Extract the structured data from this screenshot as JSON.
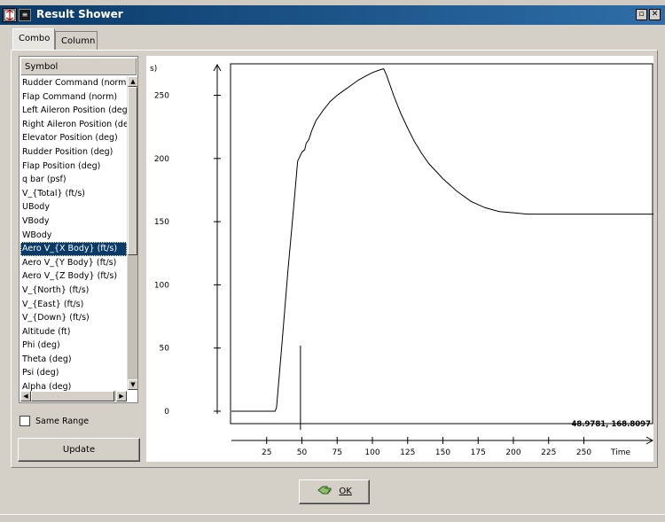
{
  "window": {
    "title": "Result Shower"
  },
  "tabs": [
    {
      "label": "Combo",
      "active": true
    },
    {
      "label": "Column",
      "active": false
    }
  ],
  "list": {
    "header": "Symbol",
    "items": [
      "Rudder Command (norm)",
      "Flap Command (norm)",
      "Left Aileron Position (deg)",
      "Right Aileron Position (deg)",
      "Elevator Position (deg)",
      "Rudder Position (deg)",
      "Flap Position (deg)",
      "q bar (psf)",
      "V_{Total} (ft/s)",
      "UBody",
      "VBody",
      "WBody",
      "Aero V_{X Body} (ft/s)",
      "Aero V_{Y Body} (ft/s)",
      "Aero V_{Z Body} (ft/s)",
      "V_{North} (ft/s)",
      "V_{East} (ft/s)",
      "V_{Down} (ft/s)",
      "Altitude (ft)",
      "Phi (deg)",
      "Theta (deg)",
      "Psi (deg)",
      "Alpha (deg)"
    ],
    "selected_index": 12
  },
  "same_range": {
    "label": "Same Range",
    "checked": false
  },
  "buttons": {
    "update": "Update",
    "ok": "OK"
  },
  "plot": {
    "cursor_readout": "48.9781, 168.8097",
    "y_label_fragment": "s)"
  },
  "chart_data": {
    "type": "line",
    "title": "",
    "xlabel": "Time",
    "ylabel": "",
    "xlim": [
      0,
      300
    ],
    "ylim": [
      0,
      270
    ],
    "x_ticks": [
      25,
      50,
      75,
      100,
      125,
      150,
      175,
      200,
      225,
      250
    ],
    "y_ticks": [
      0,
      50,
      100,
      150,
      200,
      250
    ],
    "grid": false,
    "cursor_marker_x": 48.98,
    "series": [
      {
        "x": [
          0,
          8,
          31,
          32,
          36,
          40,
          44,
          47,
          50,
          52,
          53,
          55,
          57,
          60,
          65,
          70,
          75,
          80,
          85,
          90,
          95,
          100,
          105,
          108,
          110,
          115,
          120,
          125,
          130,
          135,
          140,
          150,
          160,
          170,
          180,
          190,
          200,
          210,
          225,
          250,
          275,
          300
        ],
        "y": [
          0,
          0,
          0,
          3,
          55,
          110,
          160,
          198,
          205,
          207,
          212,
          215,
          222,
          230,
          238,
          245,
          250,
          254,
          258,
          262,
          265,
          268,
          270,
          271,
          266,
          250,
          236,
          224,
          213,
          204,
          196,
          184,
          174,
          166,
          161,
          158,
          157,
          156,
          156,
          156,
          156,
          156
        ]
      }
    ]
  }
}
